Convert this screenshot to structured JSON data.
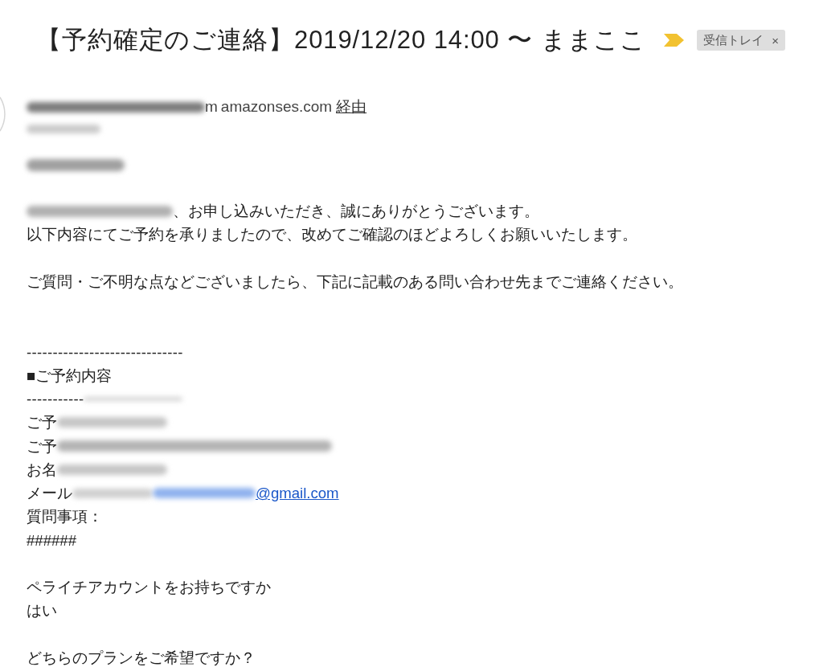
{
  "email": {
    "subject": "【予約確定のご連絡】2019/12/20 14:00 〜 ままここ",
    "important": true,
    "labels": [
      {
        "text": "受信トレイ",
        "close": "×"
      }
    ]
  },
  "header": {
    "sender_redaction": {
      "kind": "sender"
    },
    "sender_tail": "m",
    "via_domain": "amazonses.com",
    "via_label": "経由",
    "redacted_rows": [
      {
        "kind": "recipient"
      },
      {
        "kind": "greeting"
      }
    ]
  },
  "body": [
    {
      "kind": "sentence",
      "redaction_lead": {
        "kind": "medium"
      },
      "text": "、お申し込みいただき、誠にありがとうございます。"
    },
    {
      "kind": "sentence",
      "text": "以下内容にてご予約を承りましたので、改めてご確認のほどよろしくお願いいたします。"
    },
    {
      "kind": "blank"
    },
    {
      "kind": "sentence",
      "text": "ご質問・ご不明な点などございましたら、下記に記載のある問い合わせ先までご連絡ください。"
    },
    {
      "kind": "blank"
    },
    {
      "kind": "blank"
    },
    {
      "kind": "rule",
      "text": "------------------------------"
    },
    {
      "kind": "heading",
      "text": "■ご予約内容"
    },
    {
      "kind": "rule",
      "text": "-----------",
      "redaction": {
        "kind": "rule"
      }
    },
    {
      "kind": "field",
      "text": "ご予",
      "redaction": {
        "kind": "short"
      }
    },
    {
      "kind": "field",
      "text": "ご予",
      "redaction": {
        "kind": "long"
      }
    },
    {
      "kind": "field",
      "text": "お名",
      "redaction": {
        "kind": "short"
      }
    },
    {
      "kind": "field",
      "text": "メール",
      "redaction": {
        "kind": "email"
      },
      "link": "@gmail.com"
    },
    {
      "kind": "field",
      "text": "質問事項："
    },
    {
      "kind": "answer",
      "text": "######"
    },
    {
      "kind": "blank"
    },
    {
      "kind": "question",
      "text": "ペライチアカウントをお持ちですか"
    },
    {
      "kind": "answer",
      "text": "はい"
    },
    {
      "kind": "blank"
    },
    {
      "kind": "question",
      "text": "どちらのプランをご希望ですか？"
    }
  ]
}
